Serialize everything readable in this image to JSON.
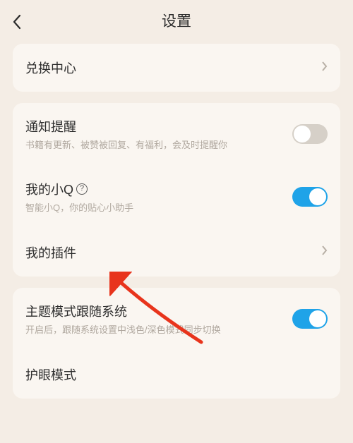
{
  "header": {
    "title": "设置"
  },
  "card1": {
    "exchange": {
      "title": "兑换中心"
    }
  },
  "card2": {
    "notify": {
      "title": "通知提醒",
      "subtitle": "书籍有更新、被赞被回复、有福利，会及时提醒你",
      "on": false
    },
    "littleQ": {
      "title": "我的小Q",
      "subtitle": "智能小Q，你的贴心小助手",
      "on": true
    },
    "plugin": {
      "title": "我的插件"
    }
  },
  "card3": {
    "theme": {
      "title": "主题模式跟随系统",
      "subtitle": "开启后，跟随系统设置中浅色/深色模式同步切换",
      "on": true
    },
    "eyecare": {
      "title": "护眼模式"
    }
  }
}
